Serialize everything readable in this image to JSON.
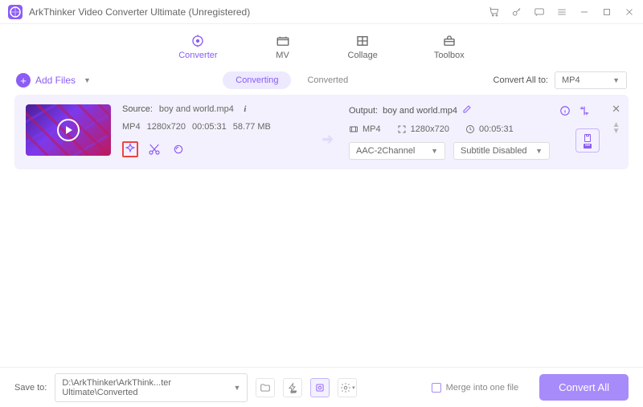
{
  "app": {
    "title": "ArkThinker Video Converter Ultimate (Unregistered)"
  },
  "tabs": {
    "converter": "Converter",
    "mv": "MV",
    "collage": "Collage",
    "toolbox": "Toolbox"
  },
  "toolbar": {
    "add_files": "Add Files",
    "converting": "Converting",
    "converted": "Converted",
    "convert_all_to": "Convert All to:",
    "format": "MP4"
  },
  "file": {
    "source_label": "Source:",
    "source_name": "boy and world.mp4",
    "format": "MP4",
    "resolution": "1280x720",
    "duration": "00:05:31",
    "size": "58.77 MB",
    "output_label": "Output:",
    "output_name": "boy and world.mp4",
    "out_format": "MP4",
    "out_resolution": "1280x720",
    "out_duration": "00:05:31",
    "audio_select": "AAC-2Channel",
    "subtitle_select": "Subtitle Disabled"
  },
  "bottom": {
    "save_to_label": "Save to:",
    "save_path": "D:\\ArkThinker\\ArkThink...ter Ultimate\\Converted",
    "merge_label": "Merge into one file",
    "convert_all_btn": "Convert All"
  }
}
